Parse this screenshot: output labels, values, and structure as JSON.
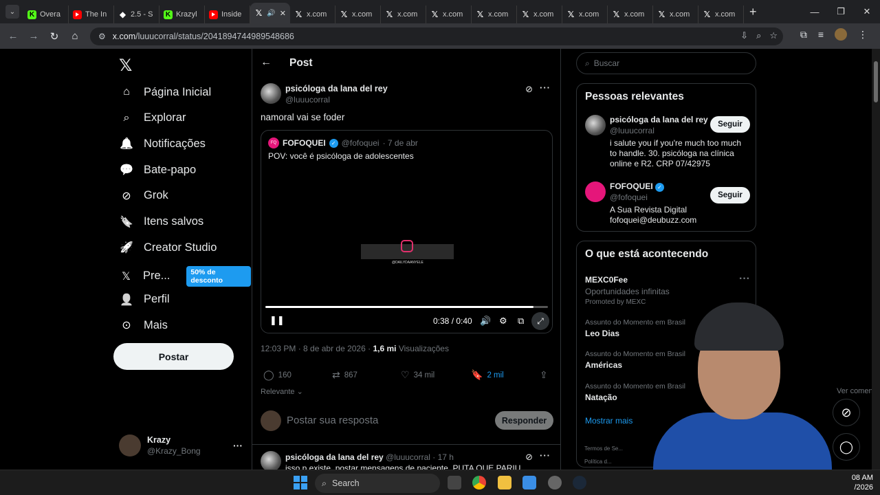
{
  "browser": {
    "tabs": [
      {
        "label": "Overa",
        "favicon": "kick-icon"
      },
      {
        "label": "The In",
        "favicon": "youtube-icon"
      },
      {
        "label": "2.5 - S",
        "favicon": "shield-icon"
      },
      {
        "label": "Krazyl",
        "favicon": "kick-icon"
      },
      {
        "label": "Inside",
        "favicon": "youtube-icon"
      },
      {
        "label": "",
        "favicon": "x-icon",
        "active": true
      },
      {
        "label": "x.com",
        "favicon": "x-icon"
      },
      {
        "label": "x.com",
        "favicon": "x-icon"
      },
      {
        "label": "x.com",
        "favicon": "x-icon"
      },
      {
        "label": "x.com",
        "favicon": "x-icon"
      },
      {
        "label": "x.com",
        "favicon": "x-icon"
      },
      {
        "label": "x.com",
        "favicon": "x-icon"
      },
      {
        "label": "x.com",
        "favicon": "x-icon"
      },
      {
        "label": "x.com",
        "favicon": "x-icon"
      },
      {
        "label": "x.com",
        "favicon": "x-icon"
      },
      {
        "label": "x.com",
        "favicon": "x-icon"
      }
    ],
    "url_host": "x.com",
    "url_path": "/luuucorral/status/2041894744989548686"
  },
  "nav": {
    "items": [
      {
        "label": "Página Inicial",
        "icon": "home-icon"
      },
      {
        "label": "Explorar",
        "icon": "search-icon"
      },
      {
        "label": "Notificações",
        "icon": "bell-icon"
      },
      {
        "label": "Bate-papo",
        "icon": "chat-icon"
      },
      {
        "label": "Grok",
        "icon": "grok-icon"
      },
      {
        "label": "Itens salvos",
        "icon": "bookmark-icon"
      },
      {
        "label": "Creator Studio",
        "icon": "rocket-icon"
      },
      {
        "label": "Pre...",
        "icon": "x-icon"
      },
      {
        "label": "Perfil",
        "icon": "person-icon"
      },
      {
        "label": "Mais",
        "icon": "more-circle-icon"
      }
    ],
    "premium_badge": "50% de desconto",
    "post_button": "Postar",
    "account": {
      "name": "Krazy",
      "handle": "@Krazy_Bong"
    }
  },
  "main": {
    "title": "Post",
    "author": {
      "name": "psicóloga da lana del rey",
      "handle": "@luuucorral"
    },
    "text": "namoral vai se foder",
    "quote": {
      "author": "FOFOQUEI",
      "handle": "@fofoquei",
      "time": "· 7 de abr",
      "text": "POV: você é psicóloga de adolescentes",
      "video_time": "0:38 / 0:40",
      "video_tag": "@DAILYDAANYELE",
      "progress": 0.95
    },
    "meta": {
      "time": "12:03 PM · 8 de abr de 2026 ·",
      "views": "1,6 mi",
      "views_label": "Visualizações"
    },
    "actions": {
      "replies": "160",
      "reposts": "867",
      "likes": "34 mil",
      "bookmarks": "2 mil"
    },
    "sort": {
      "label": "Relevante",
      "view_comments": "Ver comentários"
    },
    "reply": {
      "placeholder": "Postar sua resposta",
      "button": "Responder"
    },
    "reply2": {
      "name": "psicóloga da lana del rey",
      "handle": "@luuucorral · 17 h",
      "text": "isso p existe, postar mensagens de paciente, PUTA QUE PARIU"
    }
  },
  "sidebar": {
    "search_placeholder": "Buscar",
    "relevant_title": "Pessoas relevantes",
    "people": [
      {
        "name": "psicóloga da lana del rey",
        "handle": "@luuucorral",
        "bio": "i salute you if you're much too much to handle. 30. psicóloga na clínica online e R2. CRP 07/42975",
        "follow": "Seguir"
      },
      {
        "name": "FOFOQUEI",
        "handle": "@fofoquei",
        "bio": "A Sua Revista Digital fofoquei@deubuzz.com",
        "follow": "Seguir"
      }
    ],
    "trends_title": "O que está acontecendo",
    "trends": [
      {
        "category": "",
        "name": "MEXC0Fee",
        "sub": "Oportunidades infinitas",
        "promo": "Promoted by MEXC"
      },
      {
        "category": "Assunto do Momento em Brasil",
        "name": "Leo Dias"
      },
      {
        "category": "Assunto do Momento em Brasil",
        "name": "Américas"
      },
      {
        "category": "Assunto do Momento em Brasil",
        "name": "Natação"
      }
    ],
    "show_more": "Mostrar mais",
    "footer": [
      "Termos de Se...",
      "Política d..."
    ]
  },
  "taskbar": {
    "search": "Search",
    "clock_time": "08 AM",
    "clock_date": "/2026"
  },
  "colors": {
    "accent": "#1d9bf0",
    "background": "#000000",
    "border": "#2f3336",
    "muted": "#71767b"
  }
}
